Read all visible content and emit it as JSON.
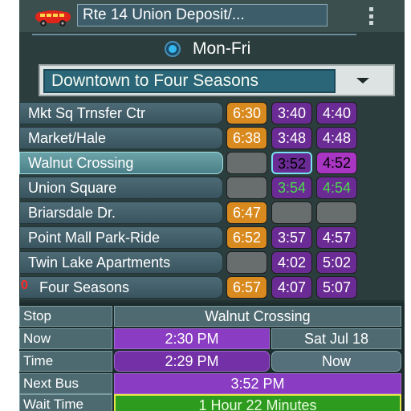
{
  "header": {
    "route_title": "Rte 14  Union Deposit/...",
    "bus_icon": "bus-icon",
    "menu_icon": "overflow-menu-icon"
  },
  "schedule": {
    "day_label": "Mon-Fri",
    "direction": "Downtown to Four Seasons"
  },
  "stops": [
    {
      "name": "Mkt Sq Trnsfer Ctr",
      "marker": "",
      "times": [
        "6:30",
        "3:40",
        "4:40"
      ]
    },
    {
      "name": "Market/Hale",
      "marker": "",
      "times": [
        "6:38",
        "3:48",
        "4:48"
      ]
    },
    {
      "name": "Walnut Crossing",
      "marker": "",
      "times": [
        "",
        "3:52",
        "4:52"
      ]
    },
    {
      "name": "Union Square",
      "marker": "",
      "times": [
        "",
        "3:54",
        "4:54"
      ]
    },
    {
      "name": "Briarsdale Dr.",
      "marker": "",
      "times": [
        "6:47",
        "",
        ""
      ]
    },
    {
      "name": "Point Mall Park-Ride",
      "marker": "",
      "times": [
        "6:52",
        "3:57",
        "4:57"
      ]
    },
    {
      "name": "Twin Lake Apartments",
      "marker": "",
      "times": [
        "",
        "4:02",
        "5:02"
      ]
    },
    {
      "name": "Four Seasons",
      "marker": "0",
      "times": [
        "6:57",
        "4:07",
        "5:07"
      ]
    }
  ],
  "info": {
    "stop_label": "Stop",
    "stop_value": "Walnut Crossing",
    "now_label": "Now",
    "now_time": "2:30 PM",
    "now_date": "Sat Jul 18",
    "time_label": "Time",
    "time_value": "2:29 PM",
    "time_now_button": "Now",
    "next_bus_label": "Next Bus",
    "next_bus_value": "3:52 PM",
    "wait_label": "Wait Time",
    "wait_value": "1 Hour 22 Minutes"
  },
  "colors": {
    "early_run": "#d98a1f",
    "regular_run": "#6a2c94",
    "selected_cell_border": "#78e0f0",
    "green_text": "#4dd84d",
    "wait_time_bg": "#2d9c1e"
  }
}
